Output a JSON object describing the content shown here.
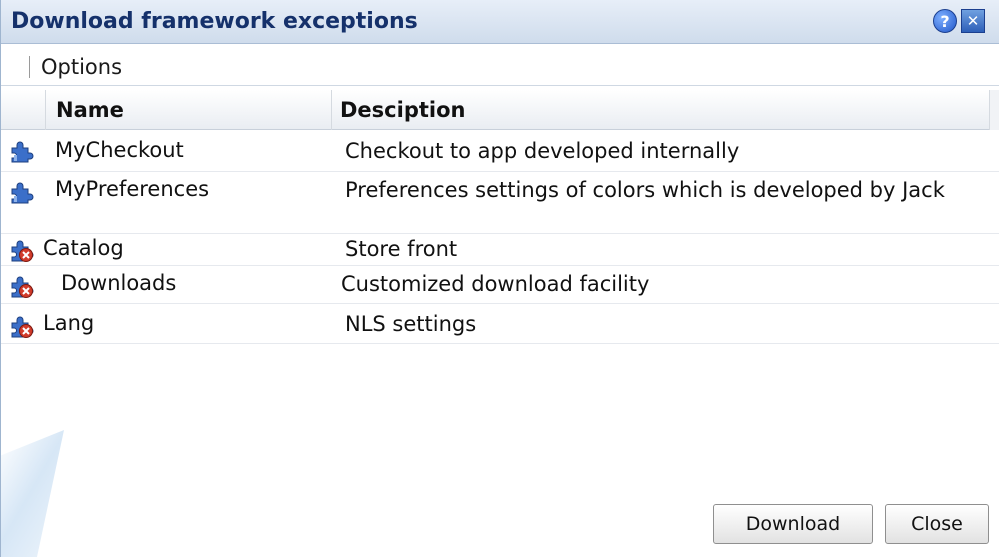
{
  "dialog": {
    "title": "Download framework exceptions",
    "help_icon": "question-mark-icon",
    "close_icon": "close-x-icon"
  },
  "menu": {
    "options_label": "Options"
  },
  "table": {
    "columns": [
      "Name",
      "Desciption"
    ],
    "rows": [
      {
        "name": "MyCheckout",
        "description": "Checkout to app developed internally",
        "icon": "puzzle-piece-icon"
      },
      {
        "name": "MyPreferences",
        "description": "Preferences settings of colors which is developed by Jack",
        "icon": "puzzle-piece-icon"
      },
      {
        "name": "Catalog",
        "description": "Store front",
        "icon": "puzzle-piece-disabled-icon"
      },
      {
        "name": "Downloads",
        "description": "Customized download facility",
        "icon": "puzzle-piece-disabled-icon"
      },
      {
        "name": "Lang",
        "description": "NLS settings",
        "icon": "puzzle-piece-disabled-icon"
      }
    ]
  },
  "buttons": {
    "download_label": "Download",
    "close_label": "Close"
  },
  "colors": {
    "title_text": "#15316b",
    "titlebar_bg": "#cfdcec",
    "plugin_blue": "#3b6fc9",
    "disabled_red": "#d23b2b"
  }
}
